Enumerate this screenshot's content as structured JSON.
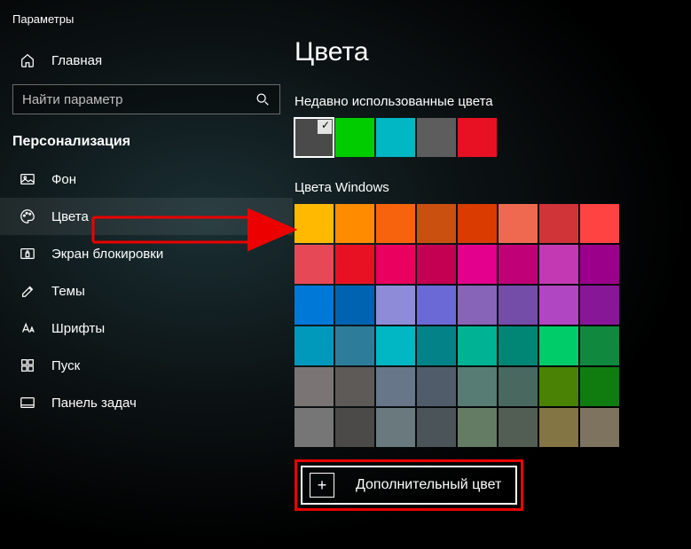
{
  "app_title": "Параметры",
  "home_label": "Главная",
  "search": {
    "placeholder": "Найти параметр"
  },
  "section": "Персонализация",
  "nav": {
    "background": "Фон",
    "colors": "Цвета",
    "lockscreen": "Экран блокировки",
    "themes": "Темы",
    "fonts": "Шрифты",
    "start": "Пуск",
    "taskbar": "Панель задач"
  },
  "page_title": "Цвета",
  "recent_heading": "Недавно использованные цвета",
  "recent_colors": [
    "#4a4a4a",
    "#00cc00",
    "#00b7c3",
    "#5d5d5d",
    "#e81123"
  ],
  "recent_selected_index": 0,
  "windows_heading": "Цвета Windows",
  "windows_colors": [
    "#ffb900",
    "#ff8c00",
    "#f7630c",
    "#ca5010",
    "#da3b01",
    "#ef6950",
    "#d13438",
    "#ff4343",
    "#e74856",
    "#e81123",
    "#ea005e",
    "#c30052",
    "#e3008c",
    "#bf0077",
    "#c239b3",
    "#9a0089",
    "#0078d7",
    "#0063b1",
    "#8e8cd8",
    "#6b69d6",
    "#8764b8",
    "#744da9",
    "#b146c2",
    "#881798",
    "#0099bc",
    "#2d7d9a",
    "#00b7c3",
    "#038387",
    "#00b294",
    "#018574",
    "#00cc6a",
    "#10893e",
    "#7a7574",
    "#5d5a58",
    "#68768a",
    "#515c6b",
    "#567c73",
    "#486860",
    "#498205",
    "#107c10",
    "#767676",
    "#4c4a48",
    "#69797e",
    "#4a5459",
    "#647c64",
    "#525e54",
    "#847545",
    "#7e735f"
  ],
  "custom_color_label": "Дополнительный цвет",
  "annotation": {
    "arrow_color": "#ec0000"
  }
}
